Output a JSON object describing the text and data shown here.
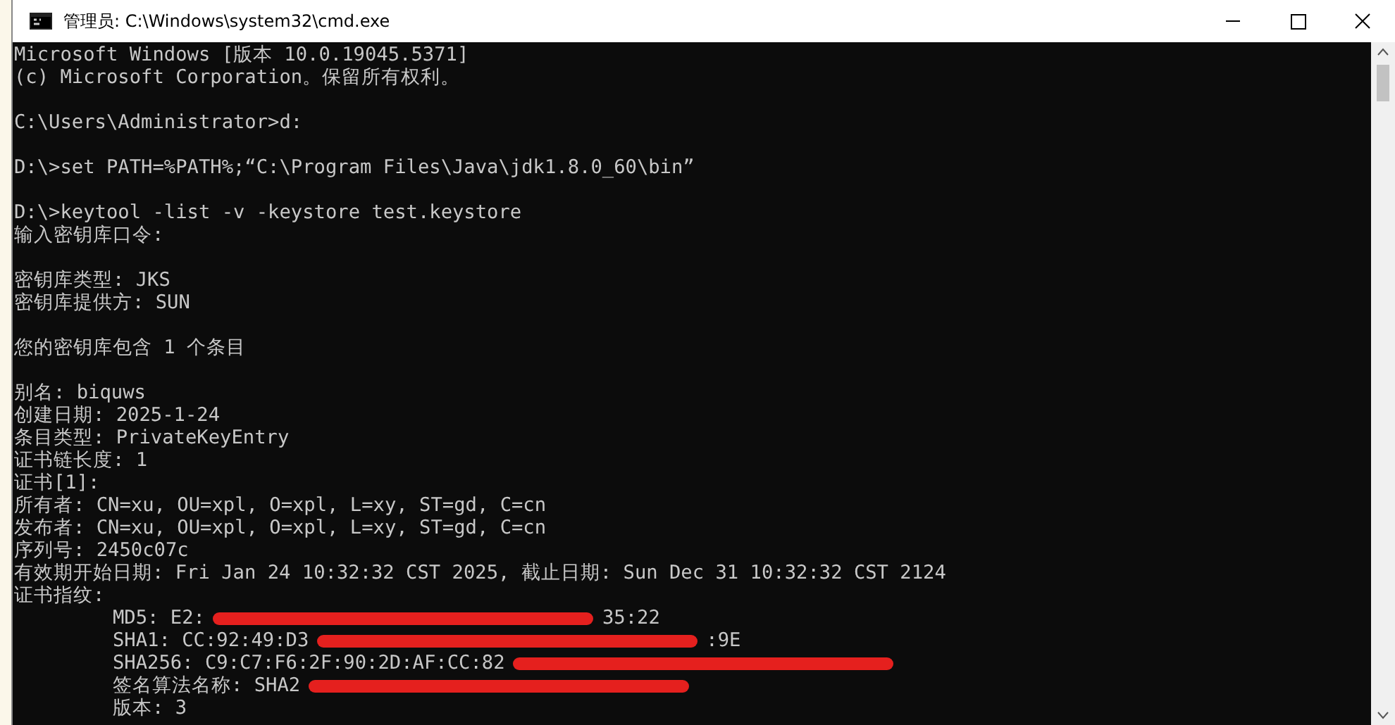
{
  "window": {
    "title": "管理员: C:\\Windows\\system32\\cmd.exe"
  },
  "console": {
    "lines": [
      {
        "kind": "plain",
        "segments": [
          {
            "kind": "text",
            "text": "Microsoft Windows [版本 10.0.19045.5371]"
          }
        ]
      },
      {
        "kind": "plain",
        "segments": [
          {
            "kind": "text",
            "text": "(c) Microsoft Corporation。保留所有权利。"
          }
        ]
      },
      {
        "kind": "blank"
      },
      {
        "kind": "plain",
        "segments": [
          {
            "kind": "text",
            "text": "C:\\Users\\Administrator>d:"
          }
        ]
      },
      {
        "kind": "blank"
      },
      {
        "kind": "plain",
        "segments": [
          {
            "kind": "text",
            "text": "D:\\>set PATH=%PATH%;“C:\\Program Files\\Java\\jdk1.8.0_60\\bin”"
          }
        ]
      },
      {
        "kind": "blank"
      },
      {
        "kind": "plain",
        "segments": [
          {
            "kind": "text",
            "text": "D:\\>keytool -list -v -keystore test.keystore"
          }
        ]
      },
      {
        "kind": "plain",
        "segments": [
          {
            "kind": "text",
            "text": "输入密钥库口令:"
          }
        ]
      },
      {
        "kind": "blank"
      },
      {
        "kind": "plain",
        "segments": [
          {
            "kind": "text",
            "text": "密钥库类型: JKS"
          }
        ]
      },
      {
        "kind": "plain",
        "segments": [
          {
            "kind": "text",
            "text": "密钥库提供方: SUN"
          }
        ]
      },
      {
        "kind": "blank"
      },
      {
        "kind": "plain",
        "segments": [
          {
            "kind": "text",
            "text": "您的密钥库包含 1 个条目"
          }
        ]
      },
      {
        "kind": "blank"
      },
      {
        "kind": "plain",
        "segments": [
          {
            "kind": "text",
            "text": "别名: biquws"
          }
        ]
      },
      {
        "kind": "plain",
        "segments": [
          {
            "kind": "text",
            "text": "创建日期: 2025-1-24"
          }
        ]
      },
      {
        "kind": "plain",
        "segments": [
          {
            "kind": "text",
            "text": "条目类型: PrivateKeyEntry"
          }
        ]
      },
      {
        "kind": "plain",
        "segments": [
          {
            "kind": "text",
            "text": "证书链长度: 1"
          }
        ]
      },
      {
        "kind": "plain",
        "segments": [
          {
            "kind": "text",
            "text": "证书[1]:"
          }
        ]
      },
      {
        "kind": "plain",
        "segments": [
          {
            "kind": "text",
            "text": "所有者: CN=xu, OU=xpl, O=xpl, L=xy, ST=gd, C=cn"
          }
        ]
      },
      {
        "kind": "plain",
        "segments": [
          {
            "kind": "text",
            "text": "发布者: CN=xu, OU=xpl, O=xpl, L=xy, ST=gd, C=cn"
          }
        ]
      },
      {
        "kind": "plain",
        "segments": [
          {
            "kind": "text",
            "text": "序列号: 2450c07c"
          }
        ]
      },
      {
        "kind": "plain",
        "segments": [
          {
            "kind": "text",
            "text": "有效期开始日期: Fri Jan 24 10:32:32 CST 2025, 截止日期: Sun Dec 31 10:32:32 CST 2124"
          }
        ]
      },
      {
        "kind": "plain",
        "segments": [
          {
            "kind": "text",
            "text": "证书指纹:"
          }
        ]
      },
      {
        "kind": "indented",
        "segments": [
          {
            "kind": "text",
            "text": "MD5: E2:"
          },
          {
            "kind": "redaction"
          },
          {
            "kind": "text",
            "text": "35:22"
          }
        ]
      },
      {
        "kind": "indented",
        "segments": [
          {
            "kind": "text",
            "text": "SHA1: CC:92:49:D3"
          },
          {
            "kind": "redaction"
          },
          {
            "kind": "text",
            "text": ":9E"
          }
        ]
      },
      {
        "kind": "indented",
        "segments": [
          {
            "kind": "text",
            "text": "SHA256: C9:C7:F6:2F:90:2D:AF:CC:82"
          },
          {
            "kind": "redaction"
          }
        ]
      },
      {
        "kind": "indented",
        "segments": [
          {
            "kind": "text",
            "text": "签名算法名称: SHA2"
          },
          {
            "kind": "redaction"
          }
        ]
      },
      {
        "kind": "indented",
        "segments": [
          {
            "kind": "text",
            "text": "版本: 3"
          }
        ]
      }
    ]
  }
}
